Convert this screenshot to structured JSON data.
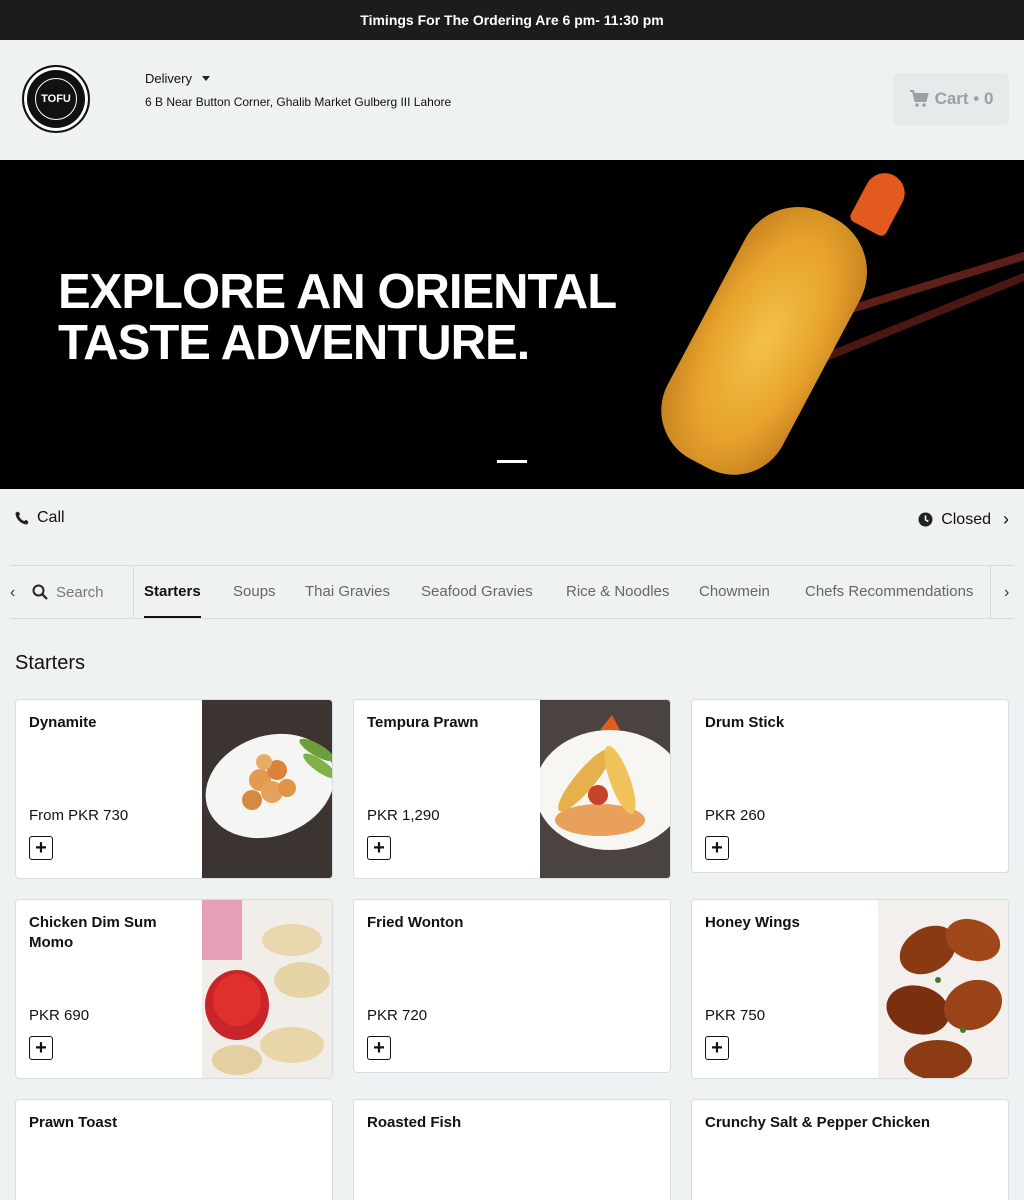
{
  "topbar": {
    "text": "Timings For The Ordering Are 6 pm- 11:30 pm"
  },
  "header": {
    "logo_text": "TOFU",
    "mode": "Delivery",
    "address": "6 B Near Button Corner, Ghalib Market Gulberg III Lahore",
    "cart_label": "Cart • 0"
  },
  "hero": {
    "line1": "EXPLORE AN ORIENTAL",
    "line2": "TASTE ADVENTURE."
  },
  "info": {
    "call": "Call",
    "status": "Closed"
  },
  "nav": {
    "search": "Search",
    "categories": [
      "Starters",
      "Soups",
      "Thai Gravies",
      "Seafood Gravies",
      "Rice & Noodles",
      "Chowmein",
      "Chefs Recommendations"
    ],
    "active": "Starters"
  },
  "section": {
    "title": "Starters"
  },
  "items": [
    {
      "name": "Dynamite",
      "price": "From PKR 730",
      "image": "dynamite-photo"
    },
    {
      "name": "Tempura Prawn",
      "price": "PKR 1,290",
      "image": "tempura-photo"
    },
    {
      "name": "Drum Stick",
      "price": "PKR 260"
    },
    {
      "name": "Chicken Dim Sum Momo",
      "price": "PKR 690",
      "image": "momo-photo"
    },
    {
      "name": "Fried Wonton",
      "price": "PKR 720"
    },
    {
      "name": "Honey Wings",
      "price": "PKR 750",
      "image": "wings-photo"
    },
    {
      "name": "Prawn Toast",
      "price": ""
    },
    {
      "name": "Roasted Fish",
      "price": ""
    },
    {
      "name": "Crunchy Salt & Pepper Chicken",
      "price": ""
    }
  ],
  "colors": {
    "topbar": "#1c1c1c",
    "background": "#eef2f3",
    "card": "#ffffff",
    "muted": "#9aa0a3"
  }
}
